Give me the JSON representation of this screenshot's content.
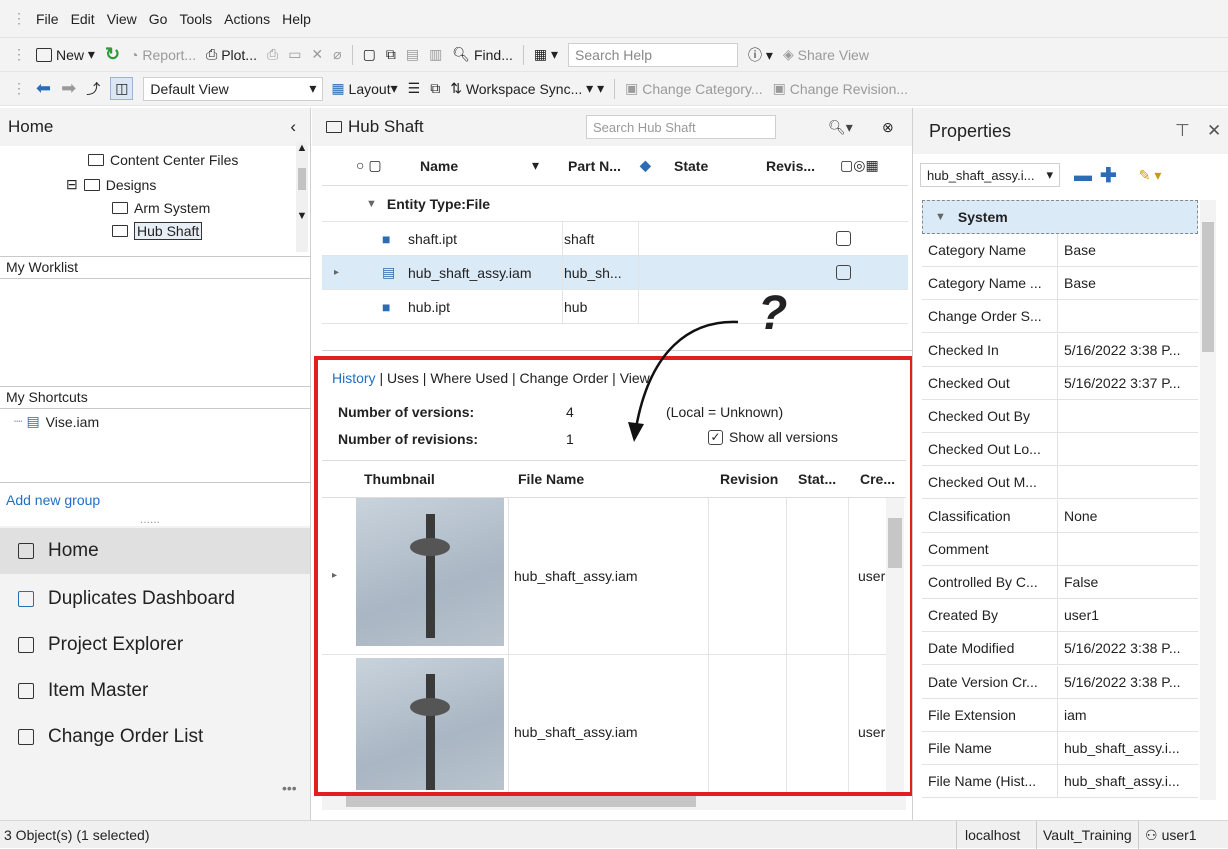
{
  "menu": [
    "File",
    "Edit",
    "View",
    "Go",
    "Tools",
    "Actions",
    "Help"
  ],
  "toolbar1": {
    "new": "New",
    "report": "Report...",
    "plot": "Plot...",
    "find": "Find...",
    "search_help": "Search Help",
    "share_view": "Share View"
  },
  "toolbar2": {
    "view": "Default View",
    "layout": "Layout",
    "workspace_sync": "Workspace Sync...",
    "change_category": "Change Category...",
    "change_revision": "Change Revision..."
  },
  "left": {
    "title": "Home",
    "tree": [
      "Content Center Files",
      "Designs",
      "Arm System",
      "Hub Shaft"
    ],
    "worklist": "My Worklist",
    "shortcuts": "My Shortcuts",
    "shortcut_item": "Vise.iam",
    "add_group": "Add new group",
    "nav": [
      "Home",
      "Duplicates Dashboard",
      "Project Explorer",
      "Item Master",
      "Change Order List"
    ]
  },
  "center": {
    "folder": "Hub Shaft",
    "search_placeholder": "Search Hub Shaft",
    "cols": [
      "Name",
      "Part N...",
      "State",
      "Revis..."
    ],
    "group": "Entity Type:File",
    "rows": [
      {
        "name": "shaft.ipt",
        "part": "shaft"
      },
      {
        "name": "hub_shaft_assy.iam",
        "part": "hub_sh..."
      },
      {
        "name": "hub.ipt",
        "part": "hub"
      }
    ]
  },
  "history": {
    "tabs": [
      "History",
      "Uses",
      "Where Used",
      "Change Order",
      "View"
    ],
    "versions_label": "Number of versions:",
    "versions": "4",
    "local": "(Local = Unknown)",
    "revisions_label": "Number of revisions:",
    "revisions": "1",
    "show_all": "Show all versions",
    "cols": [
      "Thumbnail",
      "File Name",
      "Revision",
      "Stat...",
      "Cre..."
    ],
    "rows": [
      {
        "file": "hub_shaft_assy.iam",
        "creator": "user"
      },
      {
        "file": "hub_shaft_assy.iam",
        "creator": "user"
      }
    ]
  },
  "annotation": "?",
  "props": {
    "title": "Properties",
    "selector": "hub_shaft_assy.i...",
    "group": "System",
    "rows": [
      [
        "Category Name",
        "Base"
      ],
      [
        "Category Name ...",
        "Base"
      ],
      [
        "Change Order S...",
        ""
      ],
      [
        "Checked In",
        "5/16/2022 3:38 P..."
      ],
      [
        "Checked Out",
        "5/16/2022 3:37 P..."
      ],
      [
        "Checked Out By",
        ""
      ],
      [
        "Checked Out Lo...",
        ""
      ],
      [
        "Checked Out M...",
        ""
      ],
      [
        "Classification",
        "None"
      ],
      [
        "Comment",
        ""
      ],
      [
        "Controlled By C...",
        "False"
      ],
      [
        "Created By",
        "user1"
      ],
      [
        "Date Modified",
        "5/16/2022 3:38 P..."
      ],
      [
        "Date Version Cr...",
        "5/16/2022 3:38 P..."
      ],
      [
        "File Extension",
        "iam"
      ],
      [
        "File Name",
        "hub_shaft_assy.i..."
      ],
      [
        "File Name (Hist...",
        "hub_shaft_assy.i..."
      ]
    ]
  },
  "status": {
    "left": "3 Object(s) (1 selected)",
    "server": "localhost",
    "vault": "Vault_Training",
    "user": "user1"
  },
  "colors": {
    "highlight": "#dbeaf7",
    "red_box": "#e02020",
    "link": "#1f6fc5"
  }
}
